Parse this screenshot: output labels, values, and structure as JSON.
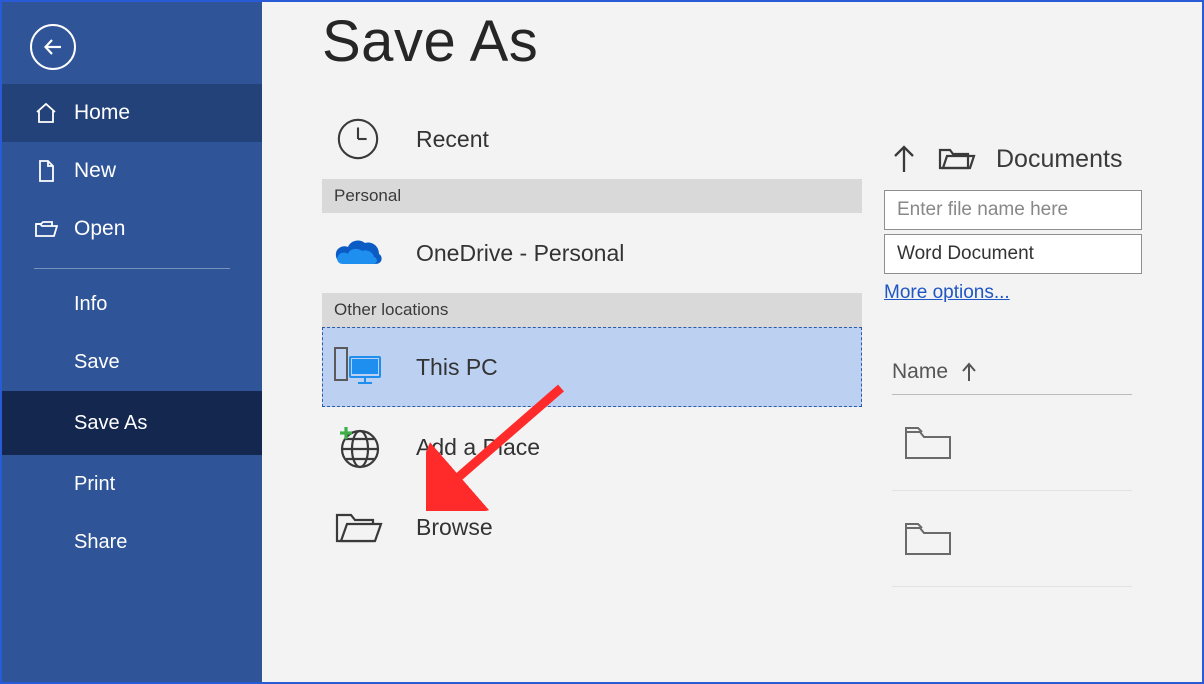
{
  "sidebar": {
    "home": "Home",
    "new": "New",
    "open": "Open",
    "info": "Info",
    "save": "Save",
    "save_as": "Save As",
    "print": "Print",
    "share": "Share"
  },
  "page_title": "Save As",
  "locations": {
    "recent": "Recent",
    "group_personal": "Personal",
    "onedrive": "OneDrive - Personal",
    "group_other": "Other locations",
    "this_pc": "This PC",
    "add_place": "Add a Place",
    "browse": "Browse"
  },
  "right": {
    "current_folder": "Documents",
    "filename_placeholder": "Enter file name here",
    "filetype": "Word Document",
    "more_options": "More options...",
    "list_header_name": "Name"
  }
}
